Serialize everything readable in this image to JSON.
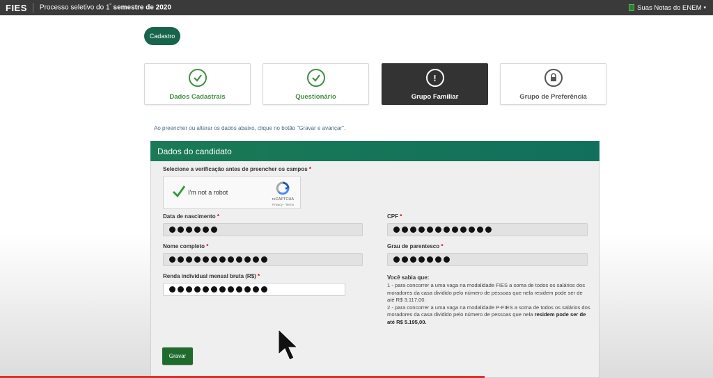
{
  "topbar": {
    "logo": "FIES",
    "subtitle_prefix": "Processo seletivo do 1",
    "subtitle_sup": "º",
    "subtitle_bold": "semestre de 2020",
    "notas_label": "Suas Notas do ENEM",
    "caret": "▾"
  },
  "cadastro_label": "Cadastro",
  "steps": [
    {
      "label": "Dados Cadastrais",
      "state": "done",
      "icon": "check-circle-icon"
    },
    {
      "label": "Questionário",
      "state": "done",
      "icon": "check-circle-icon"
    },
    {
      "label": "Grupo Familiar",
      "state": "active",
      "icon": "exclamation-circle-icon",
      "glyph": "!"
    },
    {
      "label": "Grupo de Preferência",
      "state": "locked",
      "icon": "lock-icon"
    }
  ],
  "instruction": "Ao preencher ou alterar os dados abaixo, clique no botão \"Gravar e avançar\".",
  "panel": {
    "title": "Dados do candidato",
    "verification_label": "Selecione a verificação antes de preencher os campos",
    "required_mark": "*",
    "recaptcha": {
      "text": "I'm not a robot",
      "brand": "reCAPTCHA",
      "links": "Privacy - Terms"
    },
    "fields": {
      "data_nascimento": {
        "label": "Data de nascimento",
        "masked_length": 6
      },
      "cpf": {
        "label": "CPF",
        "masked_length": 12
      },
      "nome_completo": {
        "label": "Nome completo",
        "masked_length": 12
      },
      "grau_parentesco": {
        "label": "Grau de parentesco",
        "masked_length": 7
      },
      "renda": {
        "label": "Renda individual mensal bruta (R$)",
        "masked_length": 12
      }
    },
    "info_title": "Você sabia que:",
    "info_1": "1 - para concorrer a uma vaga na modalidade FIES a soma de todos os salários dos moradores da casa dividido pelo número de pessoas que nela residem pode ser de até R$ 3.117,00.",
    "info_2_prefix": "2 - para concorrer a uma vaga na modalidade P-FIES a soma de todos os salários dos moradores da casa dividido pelo número de pessoas que nela ",
    "info_2_bold": "residem pode ser de até R$ 5.195,00.",
    "gravar_label": "Gravar"
  },
  "colors": {
    "header_green": "#17644a",
    "done_green": "#3e8e41",
    "active_dark": "#333333",
    "button_green": "#1f6b2e",
    "progress_red": "#e03030"
  }
}
